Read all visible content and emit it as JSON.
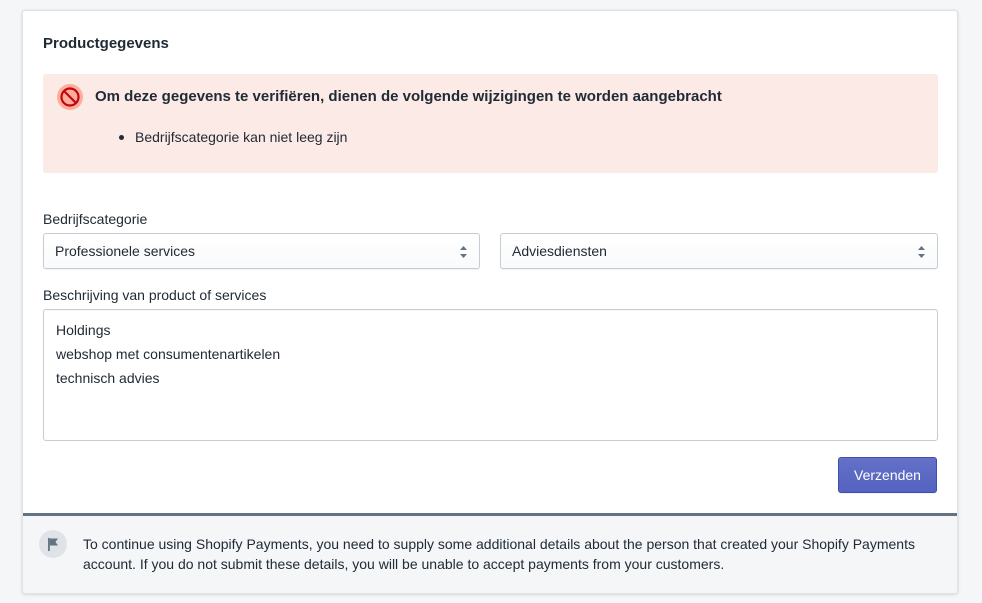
{
  "card": {
    "title": "Productgegevens"
  },
  "banner": {
    "icon": "prohibited-icon",
    "title": "Om deze gegevens te verifiëren, dienen de volgende wijzigingen te worden aangebracht",
    "items": [
      "Bedrijfscategorie kan niet leeg zijn"
    ],
    "colors": {
      "background": "#fbeae5",
      "icon_bg": "#fead9a",
      "icon": "#bf0711"
    }
  },
  "form": {
    "category_label": "Bedrijfscategorie",
    "category_value": "Professionele services",
    "subcategory_value": "Adviesdiensten",
    "description_label": "Beschrijving van product of services",
    "description_lines": [
      "Holdings",
      "webshop met consumentenartikelen",
      "technisch advies"
    ],
    "submit_label": "Verzenden",
    "colors": {
      "primary": "#5c6ac4"
    }
  },
  "footer": {
    "icon": "flag-icon",
    "text": "To continue using Shopify Payments, you need to supply some additional details about the person that created your Shopify Payments account. If you do not submit these details, you will be unable to accept payments from your customers."
  }
}
